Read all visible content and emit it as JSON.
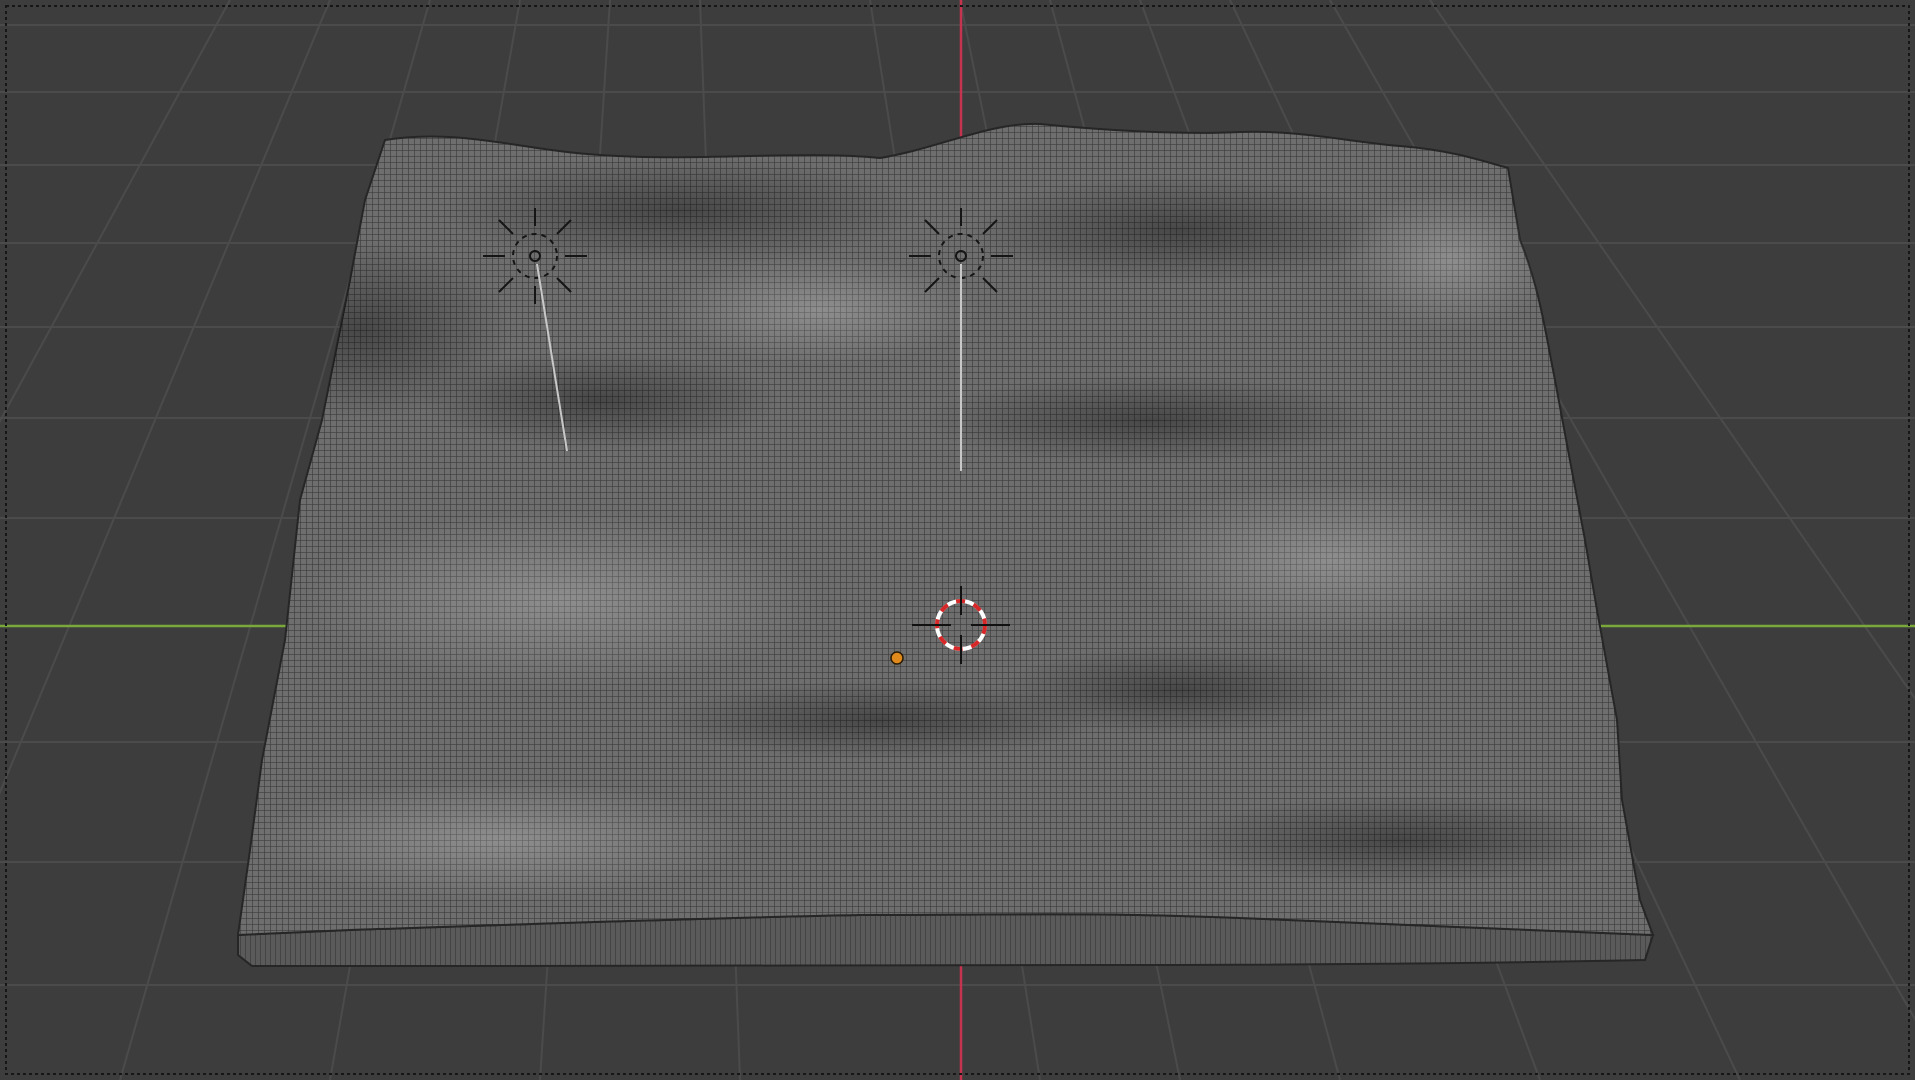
{
  "app": {
    "view": "3d-viewport",
    "shading": "wireframe"
  },
  "colors": {
    "background": "#3d3d3d",
    "grid_line": "#4c4c4c",
    "x_axis": "#c5344f",
    "y_axis": "#7aa83a",
    "mesh_fill": "#6a6a6a",
    "mesh_wire": "#3e3e3e",
    "mesh_outline": "#2a2a2a",
    "light_icon": "#151515",
    "light_line": "#c8c8c8",
    "origin_dot": "#e08a1e",
    "cursor_red": "#d62828",
    "cursor_white": "#ffffff",
    "selection_border": "#1a1a1a"
  },
  "objects": {
    "terrain": {
      "icon": "plane-mesh-icon",
      "selected": false
    },
    "lights": [
      {
        "icon": "sun-light-icon"
      },
      {
        "icon": "sun-light-icon"
      }
    ],
    "origin": {
      "icon": "origin-dot-icon"
    },
    "cursor": {
      "icon": "3d-cursor-icon"
    }
  }
}
